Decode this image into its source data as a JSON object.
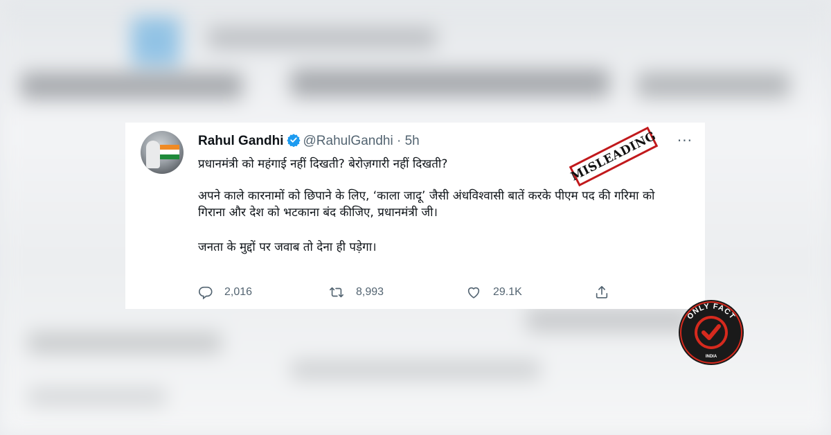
{
  "tweet": {
    "display_name": "Rahul Gandhi",
    "handle": "@RahulGandhi",
    "separator": "·",
    "time": "5h",
    "more": "···",
    "paragraphs": [
      "प्रधानमंत्री को महंगाई नहीं दिखती? बेरोज़गारी नहीं दिखती?",
      "अपने काले कारनामों को छिपाने के लिए, ‘काला जादू’ जैसी अंधविश्वासी बातें करके पीएम पद की गरिमा को गिराना और देश को भटकाना बंद कीजिए, प्रधानमंत्री जी।",
      "जनता के मुद्दों पर जवाब तो देना ही पड़ेगा।"
    ],
    "replies": "2,016",
    "retweets": "8,993",
    "likes": "29.1K"
  },
  "stamp": {
    "label": "MISLEADING",
    "color": "#c1191c"
  },
  "logo": {
    "top_text": "ONLY FACT",
    "bottom_text": "INDIA",
    "accent": "#d62a1e"
  },
  "colors": {
    "text": "#0f1419",
    "muted": "#536471",
    "verified": "#1d9bf0"
  }
}
